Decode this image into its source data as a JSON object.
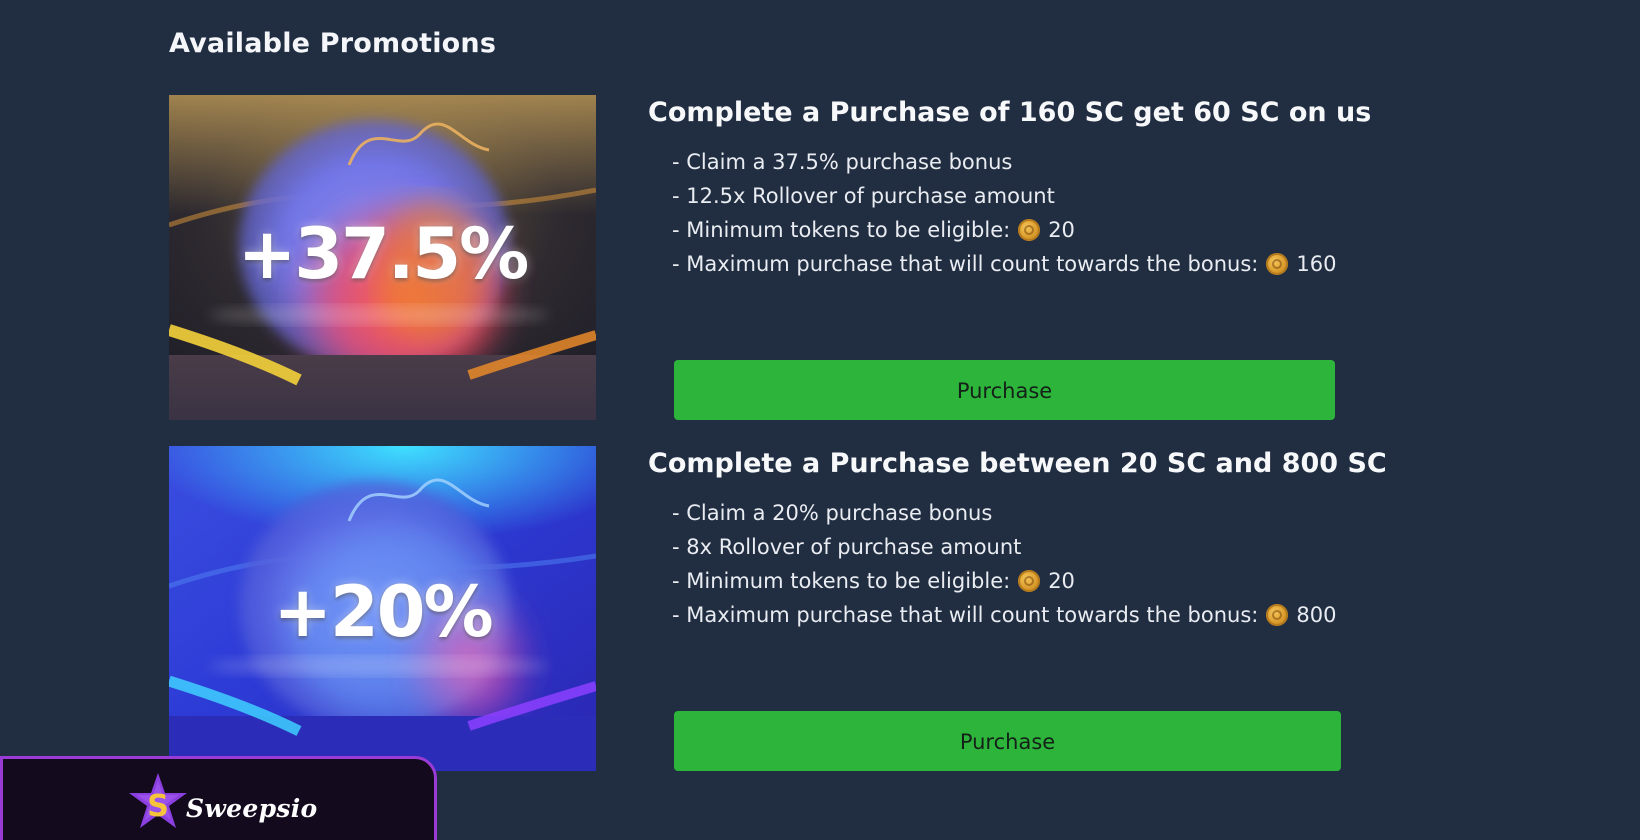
{
  "section": {
    "title": "Available Promotions"
  },
  "promotions": [
    {
      "badge": "+37.5%",
      "heading": "Complete a Purchase of 160 SC get 60 SC on us",
      "bonus_line": "- Claim a 37.5% purchase bonus",
      "rollover_line": "- 12.5x Rollover of purchase amount",
      "min_label": "- Minimum tokens to be eligible:",
      "min_value": "20",
      "max_label": "- Maximum purchase that will count towards the bonus:",
      "max_value": "160",
      "button_label": "Purchase",
      "theme": "gold"
    },
    {
      "badge": "+20%",
      "heading": "Complete a Purchase between 20 SC and 800 SC",
      "bonus_line": "- Claim a 20% purchase bonus",
      "rollover_line": "- 8x Rollover of purchase amount",
      "min_label": "- Minimum tokens to be eligible:",
      "min_value": "20",
      "max_label": "- Maximum purchase that will count towards the bonus:",
      "max_value": "800",
      "button_label": "Purchase",
      "theme": "blue"
    }
  ],
  "brand": {
    "name": "Sweepsio",
    "icon": "star-logo-icon"
  },
  "colors": {
    "background": "#212e42",
    "button": "#2db53b",
    "brand_border": "#9b3bd6",
    "coin": "#d99a2b"
  },
  "icons": {
    "coin": "coin-icon"
  }
}
